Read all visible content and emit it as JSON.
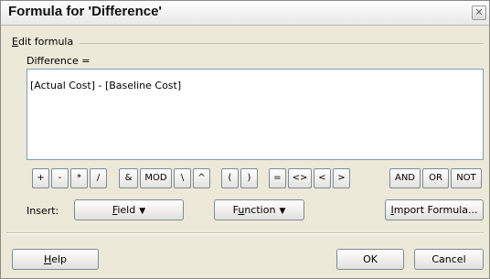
{
  "dialog": {
    "title": "Formula for 'Difference'",
    "close_glyph": "✕",
    "group": {
      "prefix": "E",
      "rest": "dit formula"
    },
    "field_label": "Difference =",
    "formula_text": "[Actual Cost] - [Baseline Cost]"
  },
  "operators": [
    "+",
    "-",
    "*",
    "/",
    "&",
    "MOD",
    "\\",
    "^",
    "(",
    ")",
    "=",
    "<>",
    "<",
    ">",
    "AND",
    "OR",
    "NOT"
  ],
  "insert": {
    "label": "Insert:",
    "field": {
      "prefix": "F",
      "rest": "ield",
      "caret": "▼"
    },
    "function": {
      "before": "F",
      "underline": "u",
      "rest": "nction",
      "caret": "▼"
    },
    "import": {
      "underline": "I",
      "rest": "mport Formula..."
    }
  },
  "footer": {
    "help": {
      "underline": "H",
      "rest": "elp"
    },
    "ok": "OK",
    "cancel": "Cancel"
  }
}
